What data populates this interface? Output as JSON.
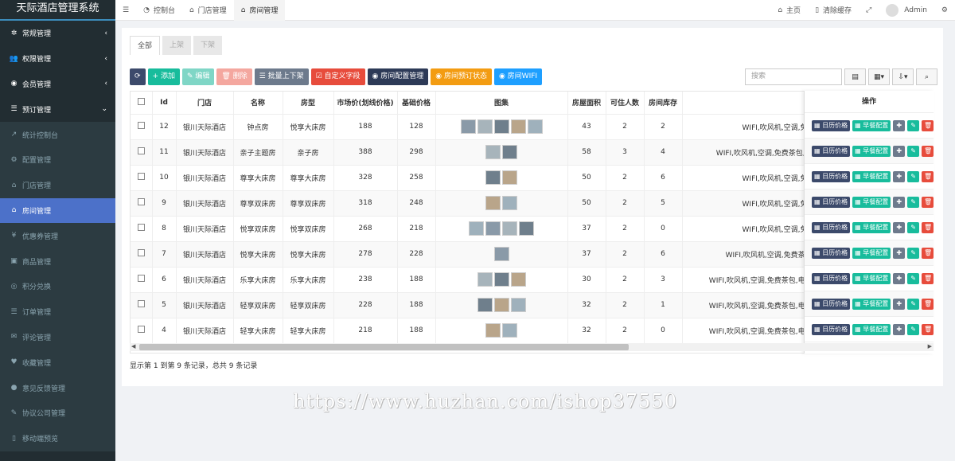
{
  "app": {
    "title": "天际酒店管理系统"
  },
  "sidebar": {
    "items": [
      {
        "label": "常规管理",
        "icon": "gears-icon",
        "arrow": "‹"
      },
      {
        "label": "权限管理",
        "icon": "users-icon",
        "arrow": "‹"
      },
      {
        "label": "会员管理",
        "icon": "user-circle-icon",
        "arrow": "‹"
      },
      {
        "label": "预订管理",
        "icon": "list-icon",
        "arrow": "⌄"
      },
      {
        "label": "统计控制台",
        "icon": "chart-icon"
      },
      {
        "label": "配置管理",
        "icon": "gear-icon"
      },
      {
        "label": "门店管理",
        "icon": "bank-icon"
      },
      {
        "label": "房间管理",
        "icon": "home-icon"
      },
      {
        "label": "优惠券管理",
        "icon": "yen-icon"
      },
      {
        "label": "商品管理",
        "icon": "cube-icon"
      },
      {
        "label": "积分兑换",
        "icon": "coins-icon"
      },
      {
        "label": "订单管理",
        "icon": "list-icon"
      },
      {
        "label": "评论管理",
        "icon": "comments-icon"
      },
      {
        "label": "收藏管理",
        "icon": "heart-icon"
      },
      {
        "label": "意见反馈管理",
        "icon": "comment-icon"
      },
      {
        "label": "协议公司管理",
        "icon": "pencil-icon"
      },
      {
        "label": "移动端预览",
        "icon": "mobile-icon"
      }
    ]
  },
  "topbar": {
    "menu_icon": "☰",
    "tabs": [
      {
        "label": "控制台",
        "icon": "dashboard-icon"
      },
      {
        "label": "门店管理",
        "icon": "bank-icon"
      },
      {
        "label": "房间管理",
        "icon": "home-icon"
      }
    ],
    "home": "主页",
    "clear_cache": "清除缓存",
    "user": "Admin"
  },
  "tabs": [
    "全部",
    "上架",
    "下架"
  ],
  "toolbar": {
    "refresh": "⟳",
    "add": "+ 添加",
    "edit": "✎ 编辑",
    "delete": "🗑 删除",
    "batch": "☰ 批量上下架",
    "custom": "☑ 自定义字段",
    "room_config": "◉ 房间配置管理",
    "book_status": "◉ 房间预订状态",
    "wifi": "◉ 房间WIFI"
  },
  "search": {
    "placeholder": "搜索"
  },
  "table": {
    "headers": [
      "Id",
      "门店",
      "名称",
      "房型",
      "市场价(划线价格)",
      "基础价格",
      "图集",
      "房屋面积",
      "可住人数",
      "房间库存",
      "操作"
    ],
    "rows": [
      {
        "id": "12",
        "store": "银川天际酒店",
        "name": "钟点房",
        "type": "悦享大床房",
        "market": "188",
        "base": "128",
        "thumbs": 5,
        "area": "43",
        "people": "2",
        "stock": "2",
        "fac": "WIFI,吹风机,空调,免费茶包"
      },
      {
        "id": "11",
        "store": "银川天际酒店",
        "name": "亲子主题房",
        "type": "亲子房",
        "market": "388",
        "base": "298",
        "thumbs": 2,
        "area": "58",
        "people": "3",
        "stock": "4",
        "fac": "WIFI,吹风机,空调,免费茶包,电视,儿"
      },
      {
        "id": "10",
        "store": "银川天际酒店",
        "name": "尊享大床房",
        "type": "尊享大床房",
        "market": "328",
        "base": "258",
        "thumbs": 2,
        "area": "50",
        "people": "2",
        "stock": "6",
        "fac": "WIFI,吹风机,空调,免费茶包"
      },
      {
        "id": "9",
        "store": "银川天际酒店",
        "name": "尊享双床房",
        "type": "尊享双床房",
        "market": "318",
        "base": "248",
        "thumbs": 2,
        "area": "50",
        "people": "2",
        "stock": "5",
        "fac": "WIFI,吹风机,空调,免费茶包"
      },
      {
        "id": "8",
        "store": "银川天际酒店",
        "name": "悦享双床房",
        "type": "悦享双床房",
        "market": "268",
        "base": "218",
        "thumbs": 4,
        "area": "37",
        "people": "2",
        "stock": "0",
        "fac": "WIFI,吹风机,空调,免费茶包"
      },
      {
        "id": "7",
        "store": "银川天际酒店",
        "name": "悦享大床房",
        "type": "悦享大床房",
        "market": "278",
        "base": "228",
        "thumbs": 1,
        "area": "37",
        "people": "2",
        "stock": "6",
        "fac": "WIFI,吹风机,空调,免费茶包,电视"
      },
      {
        "id": "6",
        "store": "银川天际酒店",
        "name": "乐享大床房",
        "type": "乐享大床房",
        "market": "238",
        "base": "188",
        "thumbs": 3,
        "area": "30",
        "people": "2",
        "stock": "3",
        "fac": "WIFI,吹风机,空调,免费茶包,电视,免费"
      },
      {
        "id": "5",
        "store": "银川天际酒店",
        "name": "轻享双床房",
        "type": "轻享双床房",
        "market": "228",
        "base": "188",
        "thumbs": 3,
        "area": "32",
        "people": "2",
        "stock": "1",
        "fac": "WIFI,吹风机,空调,免费茶包,电视,免费"
      },
      {
        "id": "4",
        "store": "银川天际酒店",
        "name": "轻享大床房",
        "type": "轻享大床房",
        "market": "218",
        "base": "188",
        "thumbs": 2,
        "area": "32",
        "people": "2",
        "stock": "0",
        "fac": "WIFI,吹风机,空调,免费茶包,电视,免费"
      }
    ],
    "ops": {
      "calendar": "日历价格",
      "breakfast": "早餐配置",
      "move": "✚",
      "edit": "✎",
      "del": "🗑"
    }
  },
  "footer": {
    "summary": "显示第 1 到第 9 条记录，总共 9 条记录"
  },
  "watermark": "https://www.huzhan.com/ishop37550"
}
